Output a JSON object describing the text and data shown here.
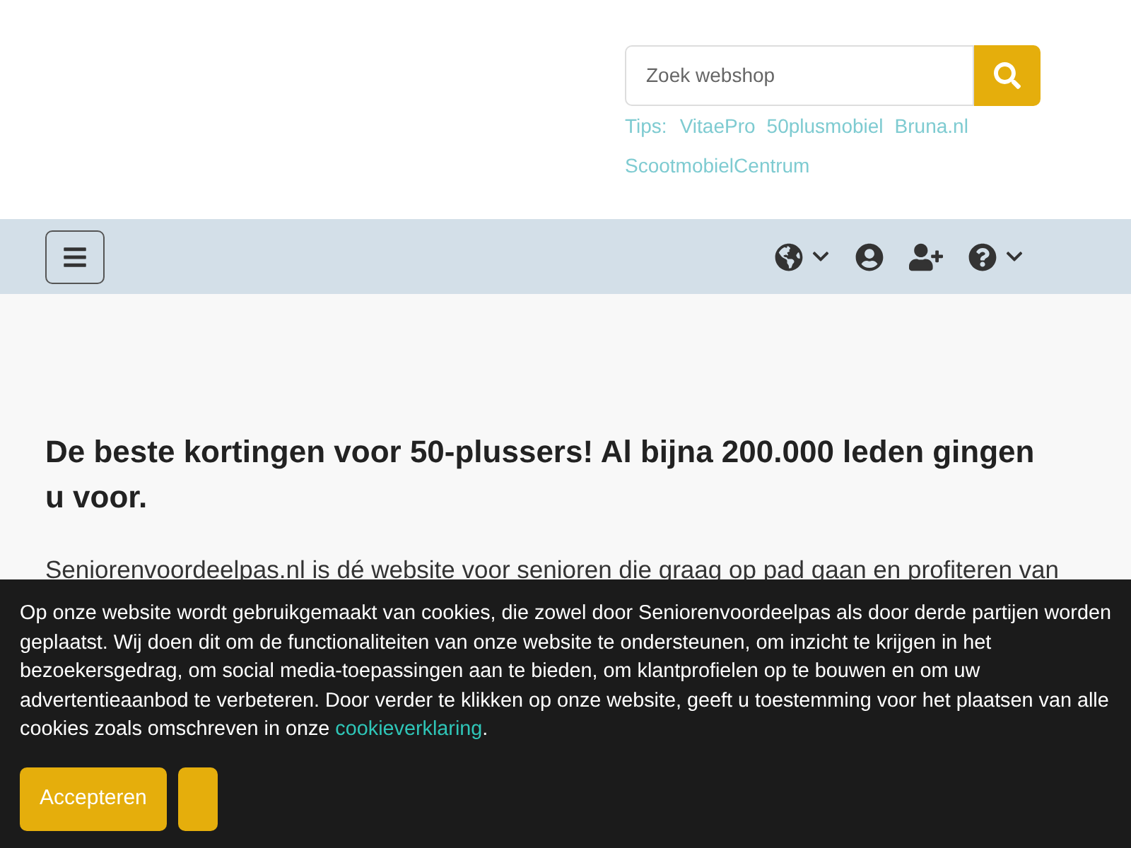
{
  "search": {
    "placeholder": "Zoek webshop",
    "tips_label": "Tips:",
    "tips": [
      "VitaePro",
      "50plusmobiel",
      "Bruna.nl",
      "ScootmobielCentrum"
    ]
  },
  "navbar": {
    "icons": [
      {
        "kind": "globe",
        "dropdown": true
      },
      {
        "kind": "user",
        "dropdown": false
      },
      {
        "kind": "user-plus",
        "dropdown": false
      },
      {
        "kind": "help",
        "dropdown": true
      }
    ]
  },
  "intro": {
    "heading": "De beste kortingen voor 50-plussers! Al bijna 200.000 leden gingen u voor.",
    "paragraph": "Seniorenvoordeelpas.nl is dé website voor senioren die graag op pad gaan en profiteren van"
  },
  "cookie_banner": {
    "text": "Op onze website wordt gebruikgemaakt van cookies, die zowel door Seniorenvoordeelpas als door derde partijen worden geplaatst. Wij doen dit om de functionaliteiten van onze website te ondersteunen, om inzicht te krijgen in het bezoekersgedrag, om social media-toepassingen aan te bieden, om klantprofielen op te bouwen en om uw advertentieaanbod te verbeteren. Door verder te klikken op onze website, geeft u toestemming voor het plaatsen van alle cookies zoals omschreven in onze",
    "link": "cookieverklaring",
    "end": ".",
    "buttons": [
      {
        "kind": "text",
        "label": "Accepteren"
      },
      {
        "kind": "blank"
      }
    ]
  }
}
